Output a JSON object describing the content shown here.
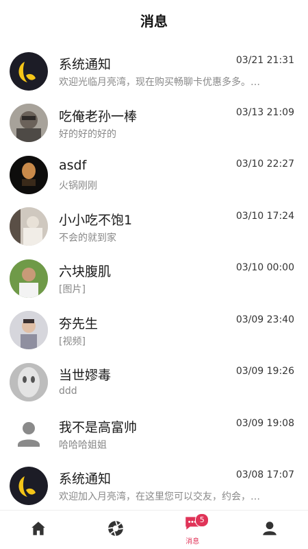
{
  "header": {
    "title": "消息"
  },
  "conversations": [
    {
      "name": "系统通知",
      "time": "03/21 21:31",
      "preview": "欢迎光临月亮湾，现在购买畅聊卡优惠多多。…",
      "avatar": "moon-logo"
    },
    {
      "name": "吃俺老孙一棒",
      "time": "03/13 21:09",
      "preview": "好的好的好的",
      "avatar": "photo"
    },
    {
      "name": "asdf",
      "time": "03/10 22:27",
      "preview": "火锅刚刚",
      "avatar": "photo"
    },
    {
      "name": "小小吃不饱1",
      "time": "03/10 17:24",
      "preview": "不会的就到家",
      "avatar": "photo"
    },
    {
      "name": "六块腹肌",
      "time": "03/10 00:00",
      "preview": "[图片]",
      "avatar": "photo"
    },
    {
      "name": "夯先生",
      "time": "03/09 23:40",
      "preview": "[视频]",
      "avatar": "photo"
    },
    {
      "name": "当世嫪毒",
      "time": "03/09 19:26",
      "preview": "ddd",
      "avatar": "photo"
    },
    {
      "name": "我不是高富帅",
      "time": "03/09 19:08",
      "preview": "哈哈哈姐姐",
      "avatar": "default-user"
    },
    {
      "name": "系统通知",
      "time": "03/08 17:07",
      "preview": "欢迎加入月亮湾，在这里您可以交友，约会，…",
      "avatar": "moon-logo"
    }
  ],
  "tabbar": {
    "tabs": [
      {
        "icon": "home-icon",
        "label": ""
      },
      {
        "icon": "aperture-icon",
        "label": ""
      },
      {
        "icon": "chat-bubble-icon",
        "label": "消息",
        "badge": "5",
        "active": true
      },
      {
        "icon": "user-icon",
        "label": ""
      }
    ]
  },
  "colors": {
    "accent": "#e03458",
    "logo_bg": "#1c1c26",
    "logo_moon": "#f5c518"
  }
}
